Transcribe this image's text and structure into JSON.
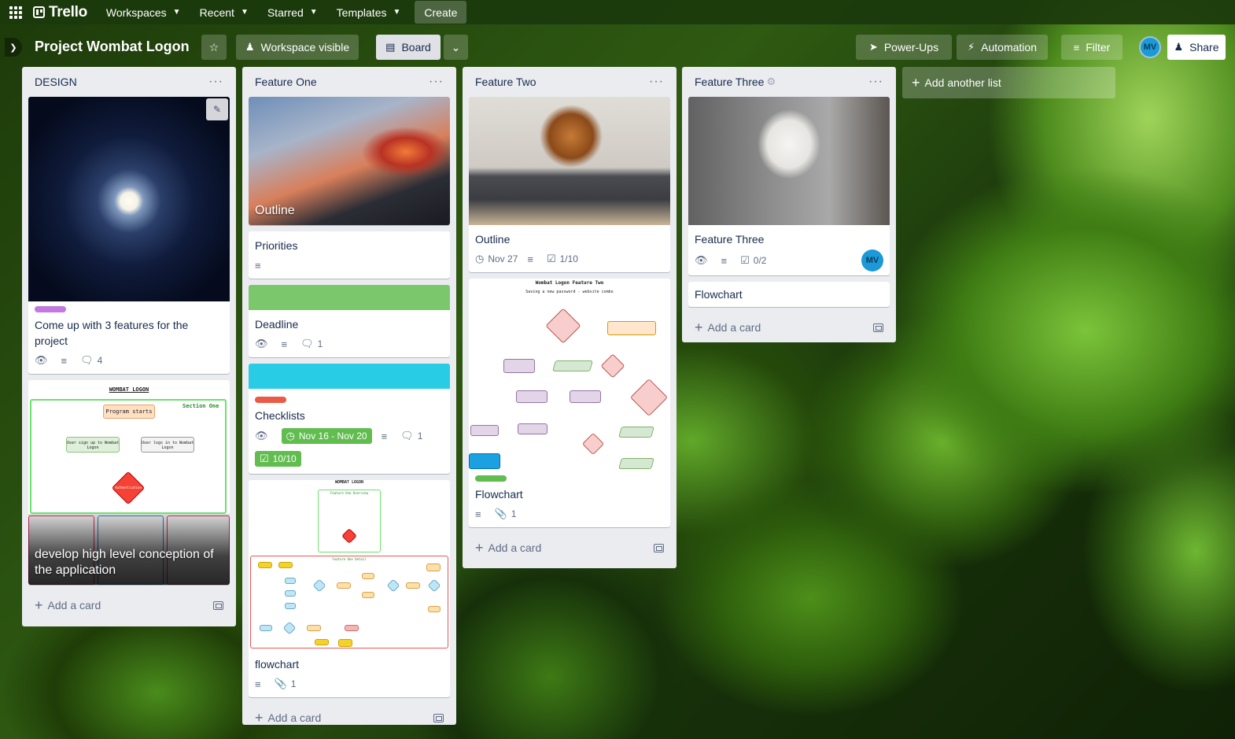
{
  "topbar": {
    "logo": "Trello",
    "nav": [
      "Workspaces",
      "Recent",
      "Starred",
      "Templates"
    ],
    "create": "Create"
  },
  "board": {
    "title": "Project Wombat Logon",
    "visibility": "Workspace visible",
    "view": "Board",
    "power_ups": "Power-Ups",
    "automation": "Automation",
    "filter": "Filter",
    "member_initials": "MV",
    "share": "Share"
  },
  "lists": [
    {
      "title": "DESIGN",
      "cards": [
        {
          "title": "Come up with 3 features for the project",
          "label_color": "#c377e0",
          "comments": "4"
        },
        {
          "title": "develop high level conception of the application",
          "flow_heading": "WOMBAT LOGON",
          "flow_section": "Section One",
          "flow_start": "Program starts",
          "flow_signup": "User sign up to Wombat Logon",
          "flow_login": "User logs in to Wombat Logon",
          "flow_auth": "Authentication"
        }
      ],
      "add_card": "Add a card"
    },
    {
      "title": "Feature One",
      "cards": [
        {
          "title": "Outline"
        },
        {
          "title": "Priorities"
        },
        {
          "title": "Deadline",
          "cover_color": "#7bc86c",
          "comments": "1"
        },
        {
          "title": "Checklists",
          "cover_color": "#29cce5",
          "label_color": "#eb5a46",
          "due": "Nov 16 - Nov 20",
          "comments": "1",
          "checklist": "10/10"
        },
        {
          "title": "flowchart",
          "attachments": "1",
          "flow_heading": "WOMBAT LOGON",
          "flow_sub": "Feature One Overview",
          "flow_detail": "Feature One Detail"
        }
      ],
      "add_card": "Add a card"
    },
    {
      "title": "Feature Two",
      "cards": [
        {
          "title": "Outline",
          "due": "Nov 27",
          "checklist": "1/10"
        },
        {
          "title": "Flowchart",
          "label_color": "#61bd4f",
          "attachments": "1",
          "flow_heading": "Wombat Logon Feature Two",
          "flow_sub": "Saving a new password - website combo"
        }
      ],
      "add_card": "Add a card"
    },
    {
      "title": "Feature Three",
      "cards": [
        {
          "title": "Feature Three",
          "checklist": "0/2",
          "member": "MV"
        },
        {
          "title": "Flowchart"
        }
      ],
      "add_card": "Add a card"
    }
  ],
  "add_list": "Add another list"
}
